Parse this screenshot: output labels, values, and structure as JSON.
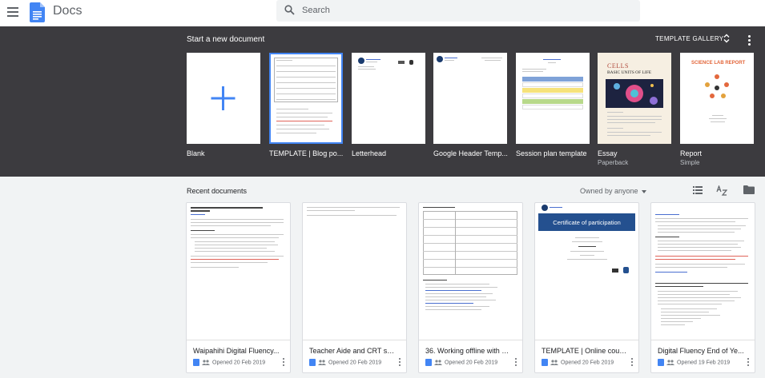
{
  "app": {
    "title": "Docs"
  },
  "search": {
    "placeholder": "Search"
  },
  "templates": {
    "heading": "Start a new document",
    "gallery_label": "TEMPLATE GALLERY",
    "items": [
      {
        "label": "Blank",
        "sub": ""
      },
      {
        "label": "TEMPLATE | Blog po...",
        "sub": ""
      },
      {
        "label": "Letterhead",
        "sub": ""
      },
      {
        "label": "Google Header Temp...",
        "sub": ""
      },
      {
        "label": "Session plan template",
        "sub": ""
      },
      {
        "label": "Essay",
        "sub": "Paperback"
      },
      {
        "label": "Report",
        "sub": "Simple"
      }
    ],
    "essay_title": "CELLS",
    "essay_subtitle": "BASIC UNITS OF LIFE",
    "report_title": "SCIENCE LAB REPORT",
    "certificate_title": "Certificate of participation"
  },
  "recent": {
    "heading": "Recent documents",
    "owner_filter": "Owned by anyone",
    "docs": [
      {
        "title": "Waipahihi Digital Fluency...",
        "opened": "Opened 20 Feb 2019"
      },
      {
        "title": "Teacher Aide and CRT sta...",
        "opened": "Opened 20 Feb 2019"
      },
      {
        "title": "36. Working offline with G...",
        "opened": "Opened 20 Feb 2019"
      },
      {
        "title": "TEMPLATE | Online cours...",
        "opened": "Opened 20 Feb 2019"
      },
      {
        "title": "Digital Fluency End of Ye...",
        "opened": "Opened 19 Feb 2019"
      }
    ]
  },
  "colors": {
    "accent": "#4285f4",
    "dark_band": "#3c3b3f",
    "background": "#f1f3f4"
  },
  "icons": [
    "hamburger-icon",
    "docs-logo-icon",
    "search-icon",
    "unfold-icon",
    "more-vert-icon",
    "list-view-icon",
    "sort-az-icon",
    "folder-icon",
    "plus-icon",
    "people-icon"
  ]
}
